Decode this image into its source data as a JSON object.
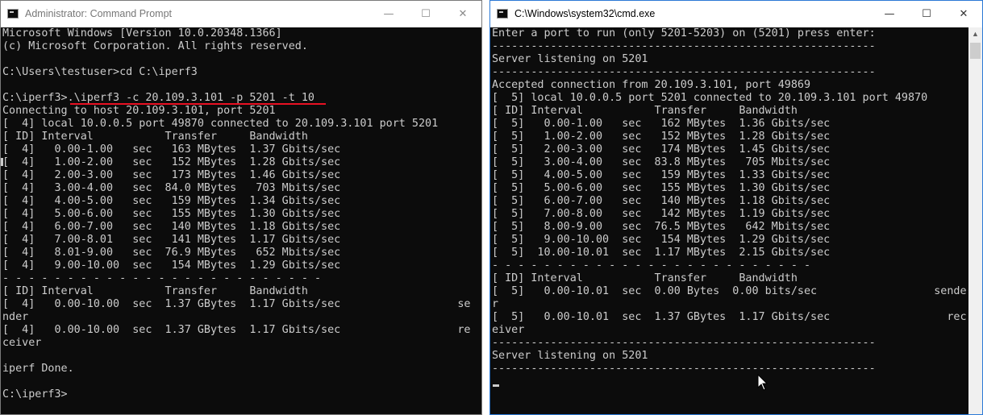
{
  "left_window": {
    "title": "Administrator: Command Prompt",
    "controls": {
      "minimize": "—",
      "maximize": "☐",
      "close": "✕"
    },
    "lines": [
      "Microsoft Windows [Version 10.0.20348.1366]",
      "(c) Microsoft Corporation. All rights reserved.",
      "",
      "C:\\Users\\testuser>cd C:\\iperf3",
      "",
      "C:\\iperf3>.\\iperf3 -c 20.109.3.101 -p 5201 -t 10",
      "Connecting to host 20.109.3.101, port 5201",
      "[  4] local 10.0.0.5 port 49870 connected to 20.109.3.101 port 5201",
      "[ ID] Interval           Transfer     Bandwidth",
      "[  4]   0.00-1.00   sec   163 MBytes  1.37 Gbits/sec",
      "[  4]   1.00-2.00   sec   152 MBytes  1.28 Gbits/sec",
      "[  4]   2.00-3.00   sec   173 MBytes  1.46 Gbits/sec",
      "[  4]   3.00-4.00   sec  84.0 MBytes   703 Mbits/sec",
      "[  4]   4.00-5.00   sec   159 MBytes  1.34 Gbits/sec",
      "[  4]   5.00-6.00   sec   155 MBytes  1.30 Gbits/sec",
      "[  4]   6.00-7.00   sec   140 MBytes  1.18 Gbits/sec",
      "[  4]   7.00-8.01   sec   141 MBytes  1.17 Gbits/sec",
      "[  4]   8.01-9.00   sec  76.9 MBytes   652 Mbits/sec",
      "[  4]   9.00-10.00  sec   154 MBytes  1.29 Gbits/sec",
      "- - - - - - - - - - - - - - - - - - - - - - - - -",
      "[ ID] Interval           Transfer     Bandwidth",
      "[  4]   0.00-10.00  sec  1.37 GBytes  1.17 Gbits/sec                  se",
      "nder",
      "[  4]   0.00-10.00  sec  1.37 GBytes  1.17 Gbits/sec                  re",
      "ceiver",
      "",
      "iperf Done.",
      "",
      "C:\\iperf3>"
    ]
  },
  "right_window": {
    "title": "C:\\Windows\\system32\\cmd.exe",
    "controls": {
      "minimize": "—",
      "maximize": "☐",
      "close": "✕"
    },
    "lines": [
      "Enter a port to run (only 5201-5203) on (5201) press enter:",
      "-----------------------------------------------------------",
      "Server listening on 5201",
      "-----------------------------------------------------------",
      "Accepted connection from 20.109.3.101, port 49869",
      "[  5] local 10.0.0.5 port 5201 connected to 20.109.3.101 port 49870",
      "[ ID] Interval           Transfer     Bandwidth",
      "[  5]   0.00-1.00   sec   162 MBytes  1.36 Gbits/sec",
      "[  5]   1.00-2.00   sec   152 MBytes  1.28 Gbits/sec",
      "[  5]   2.00-3.00   sec   174 MBytes  1.45 Gbits/sec",
      "[  5]   3.00-4.00   sec  83.8 MBytes   705 Mbits/sec",
      "[  5]   4.00-5.00   sec   159 MBytes  1.33 Gbits/sec",
      "[  5]   5.00-6.00   sec   155 MBytes  1.30 Gbits/sec",
      "[  5]   6.00-7.00   sec   140 MBytes  1.18 Gbits/sec",
      "[  5]   7.00-8.00   sec   142 MBytes  1.19 Gbits/sec",
      "[  5]   8.00-9.00   sec  76.5 MBytes   642 Mbits/sec",
      "[  5]   9.00-10.00  sec   154 MBytes  1.29 Gbits/sec",
      "[  5]  10.00-10.01  sec  1.17 MBytes  2.15 Gbits/sec",
      "- - - - - - - - - - - - - - - - - - - - - - - - -",
      "[ ID] Interval           Transfer     Bandwidth",
      "[  5]   0.00-10.01  sec  0.00 Bytes  0.00 bits/sec                  sende",
      "r",
      "[  5]   0.00-10.01  sec  1.37 GBytes  1.17 Gbits/sec                  rec",
      "eiver",
      "-----------------------------------------------------------",
      "Server listening on 5201",
      "-----------------------------------------------------------"
    ]
  },
  "colors": {
    "console_bg": "#0c0c0c",
    "console_text": "#cccccc",
    "underline_annotation": "#e81123",
    "active_border": "#2b79d6"
  },
  "icons": [
    "cmd-icon",
    "minimize-icon",
    "maximize-icon",
    "close-icon",
    "scroll-up-icon",
    "mouse-pointer-icon"
  ]
}
